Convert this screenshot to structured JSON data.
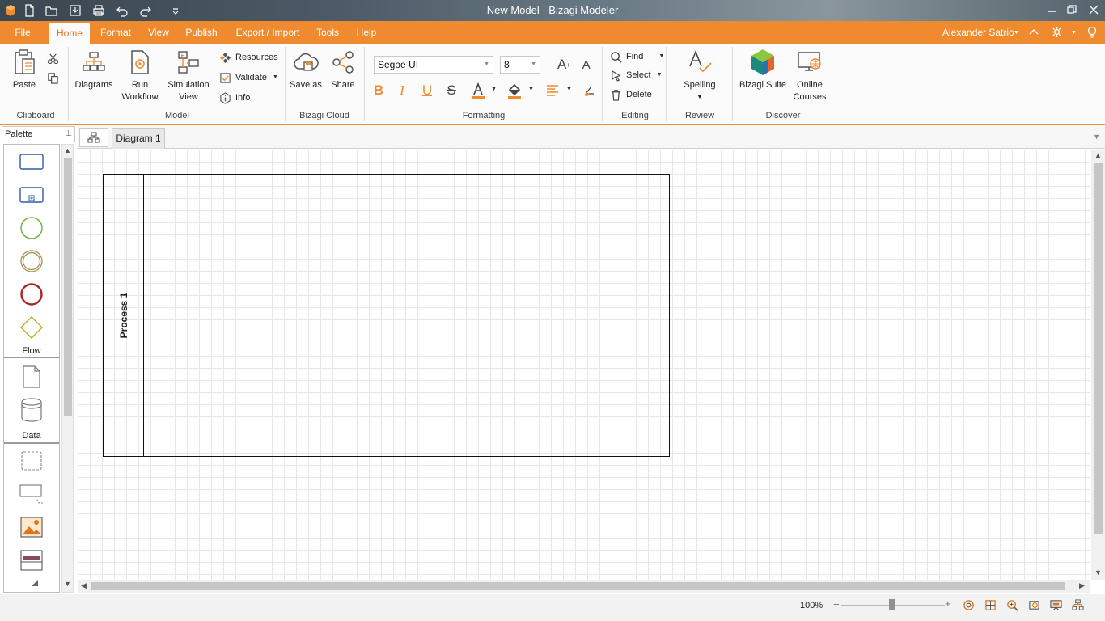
{
  "window": {
    "title": "New Model - Bizagi Modeler"
  },
  "menu": {
    "items": [
      {
        "label": "File"
      },
      {
        "label": "Home"
      },
      {
        "label": "Format"
      },
      {
        "label": "View"
      },
      {
        "label": "Publish"
      },
      {
        "label": "Export / Import"
      },
      {
        "label": "Tools"
      },
      {
        "label": "Help"
      }
    ],
    "active": "Home",
    "user": "Alexander Satrio"
  },
  "ribbon": {
    "clipboard": {
      "group": "Clipboard",
      "paste": "Paste"
    },
    "model": {
      "group": "Model",
      "diagrams": "Diagrams",
      "run_workflow_1": "Run",
      "run_workflow_2": "Workflow",
      "simulation_view_1": "Simulation",
      "simulation_view_2": "View",
      "resources": "Resources",
      "validate": "Validate",
      "info": "Info"
    },
    "cloud": {
      "group": "Bizagi Cloud",
      "save_as": "Save as",
      "share": "Share"
    },
    "formatting": {
      "group": "Formatting",
      "font": "Segoe UI",
      "size": "8"
    },
    "editing": {
      "group": "Editing",
      "find": "Find",
      "select": "Select",
      "delete": "Delete"
    },
    "review": {
      "group": "Review",
      "spelling": "Spelling"
    },
    "discover": {
      "group": "Discover",
      "suite": "Bizagi Suite",
      "courses_1": "Online",
      "courses_2": "Courses"
    }
  },
  "palette": {
    "title": "Palette",
    "sections": [
      "Flow",
      "Data"
    ]
  },
  "tabs": {
    "diagram": "Diagram 1"
  },
  "canvas": {
    "pool_name": "Process 1"
  },
  "status": {
    "zoom": "100%",
    "zoom_level": 1.0
  },
  "colors": {
    "accent": "#ef8a2e",
    "start_event": "#6fb83f",
    "intermediate_event": "#a89a55",
    "end_event": "#a8262b",
    "gateway": "#b6b21e"
  }
}
